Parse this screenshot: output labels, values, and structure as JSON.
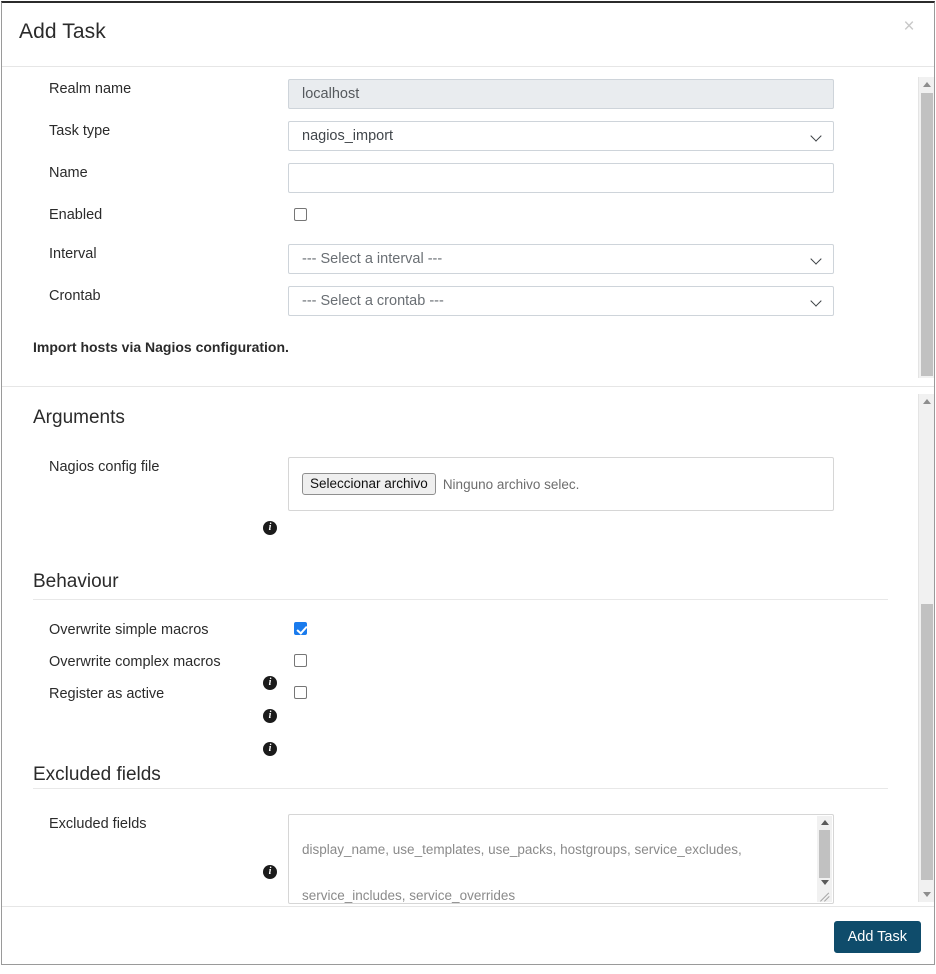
{
  "dialog": {
    "title": "Add Task",
    "close_label": "×"
  },
  "base_fields": {
    "realm": {
      "label": "Realm name",
      "value": "localhost"
    },
    "task_type": {
      "label": "Task type",
      "value": "nagios_import"
    },
    "name": {
      "label": "Name",
      "value": "",
      "placeholder": ""
    },
    "enabled": {
      "label": "Enabled",
      "checked": false
    },
    "interval": {
      "label": "Interval",
      "value": "--- Select a interval ---"
    },
    "crontab": {
      "label": "Crontab",
      "value": "--- Select a crontab ---"
    },
    "description": "Import hosts via Nagios configuration."
  },
  "arguments": {
    "heading": "Arguments",
    "config_file": {
      "label": "Nagios config file",
      "info": "i",
      "button_label": "Seleccionar archivo",
      "file_status": "Ninguno archivo selec."
    }
  },
  "behaviour": {
    "heading": "Behaviour",
    "items": [
      {
        "label": "Overwrite simple macros",
        "info": "i",
        "checked": true
      },
      {
        "label": "Overwrite complex macros",
        "info": "i",
        "checked": false
      },
      {
        "label": "Register as active",
        "info": "i",
        "checked": false
      }
    ]
  },
  "excluded": {
    "heading": "Excluded fields",
    "label": "Excluded fields",
    "info": "i",
    "value": "display_name, use_templates, use_packs, hostgroups, service_excludes, service_includes, service_overrides"
  },
  "footer": {
    "submit_label": "Add Task"
  },
  "colors": {
    "primary_button": "#0f4c6b",
    "checkbox_checked": "#1a7bed",
    "text": "#2b2b2b",
    "muted_text": "#8a8a8a",
    "border": "#ced4da"
  }
}
